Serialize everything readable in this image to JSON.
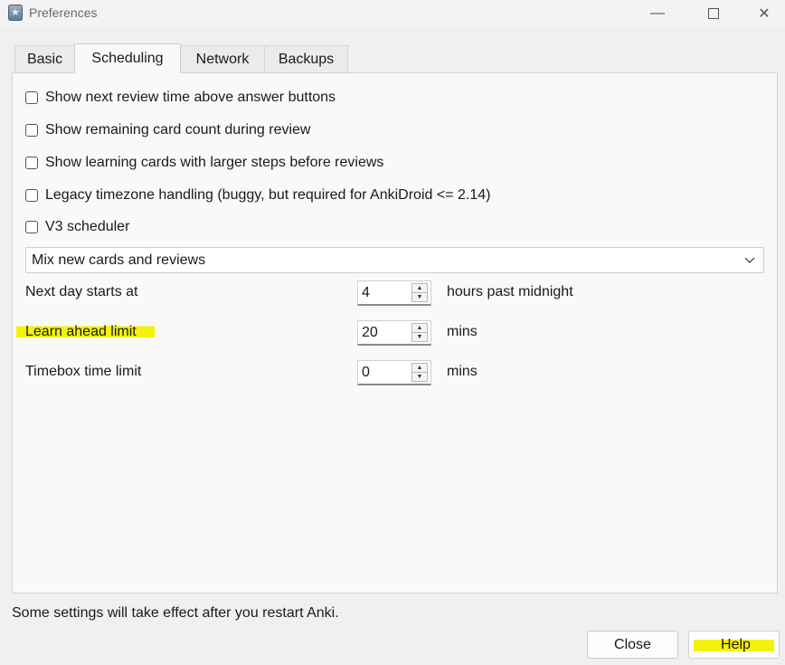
{
  "window": {
    "title": "Preferences",
    "app_icon": "anki-icon",
    "controls": [
      "minimize-icon",
      "maximize-icon",
      "close-icon"
    ]
  },
  "tabs": [
    {
      "label": "Basic",
      "active": false
    },
    {
      "label": "Scheduling",
      "active": true
    },
    {
      "label": "Network",
      "active": false
    },
    {
      "label": "Backups",
      "active": false
    }
  ],
  "checkboxes": [
    {
      "label": "Show next review time above answer buttons",
      "checked": false
    },
    {
      "label": "Show remaining card count during review",
      "checked": false
    },
    {
      "label": "Show learning cards with larger steps before reviews",
      "checked": false
    },
    {
      "label": "Legacy timezone handling (buggy, but required for AnkiDroid <= 2.14)",
      "checked": false
    },
    {
      "label": "V3 scheduler",
      "checked": false
    }
  ],
  "new_review_order": {
    "selected": "Mix new cards and reviews"
  },
  "fields": [
    {
      "label": "Next day starts at",
      "value": "4",
      "unit": "hours past midnight",
      "highlighted": false
    },
    {
      "label": "Learn ahead limit",
      "value": "20",
      "unit": "mins",
      "highlighted": true
    },
    {
      "label": "Timebox time limit",
      "value": "0",
      "unit": "mins",
      "highlighted": false
    }
  ],
  "footer": {
    "note": "Some settings will take effect after you restart Anki.",
    "close_label": "Close",
    "help_label": "Help"
  },
  "colors": {
    "highlight": "#f5f20a",
    "panel_bg": "#f9f9f9",
    "window_bg": "#f0f0f0"
  }
}
